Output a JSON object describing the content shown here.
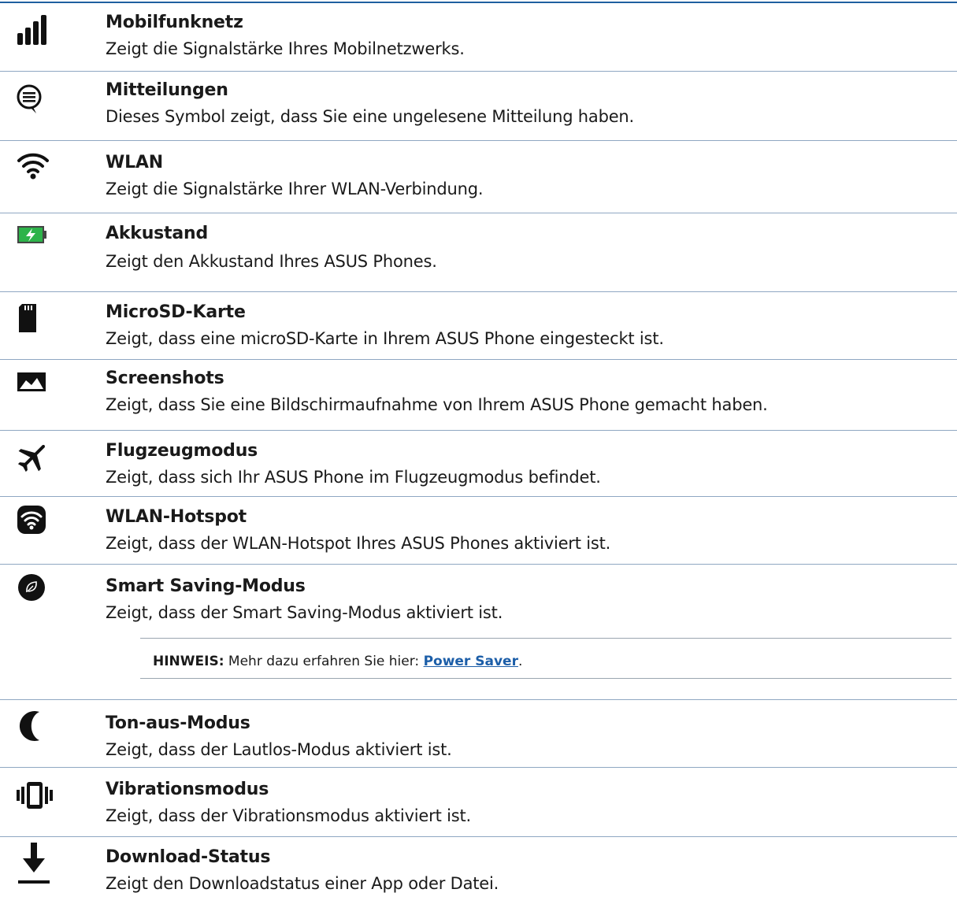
{
  "rows": [
    {
      "icon": "signal-bars-icon",
      "title": "Mobilfunknetz",
      "desc": "Zeigt die Signalstärke Ihres Mobilnetzwerks."
    },
    {
      "icon": "message-bubble-icon",
      "title": "Mitteilungen",
      "desc": "Dieses Symbol zeigt, dass Sie eine ungelesene Mitteilung haben."
    },
    {
      "icon": "wifi-icon",
      "title": "WLAN",
      "desc": "Zeigt die Signalstärke Ihrer WLAN-Verbindung."
    },
    {
      "icon": "battery-charging-icon",
      "title": "Akkustand",
      "desc": "Zeigt den Akkustand Ihres ASUS Phones."
    },
    {
      "icon": "sd-card-icon",
      "title": "MicroSD-Karte",
      "desc": "Zeigt, dass eine microSD-Karte in Ihrem ASUS Phone eingesteckt ist."
    },
    {
      "icon": "screenshot-icon",
      "title": "Screenshots",
      "desc": "Zeigt, dass Sie eine Bildschirmaufnahme von Ihrem ASUS Phone gemacht haben."
    },
    {
      "icon": "airplane-icon",
      "title": "Flugzeugmodus",
      "desc": "Zeigt, dass sich Ihr ASUS Phone im Flugzeugmodus befindet."
    },
    {
      "icon": "hotspot-icon",
      "title": "WLAN-Hotspot",
      "desc": "Zeigt, dass der WLAN-Hotspot Ihres ASUS Phones aktiviert ist."
    },
    {
      "icon": "leaf-icon",
      "title": "Smart Saving-Modus",
      "desc": "Zeigt, dass der Smart Saving-Modus aktiviert ist."
    },
    {
      "icon": "moon-icon",
      "title": "Ton-aus-Modus",
      "desc": "Zeigt, dass der Lautlos-Modus aktiviert ist."
    },
    {
      "icon": "vibrate-icon",
      "title": "Vibrationsmodus",
      "desc": "Zeigt, dass der Vibrationsmodus aktiviert ist."
    },
    {
      "icon": "download-icon",
      "title": "Download-Status",
      "desc": "Zeigt den Downloadstatus einer App oder Datei."
    }
  ],
  "note": {
    "label": "HINWEIS:",
    "text": "Mehr dazu erfahren Sie hier:",
    "link": "Power Saver",
    "end": "."
  },
  "colors": {
    "rule": "#1f5fa0",
    "link": "#1c5ea8",
    "battery": "#2db34a"
  }
}
